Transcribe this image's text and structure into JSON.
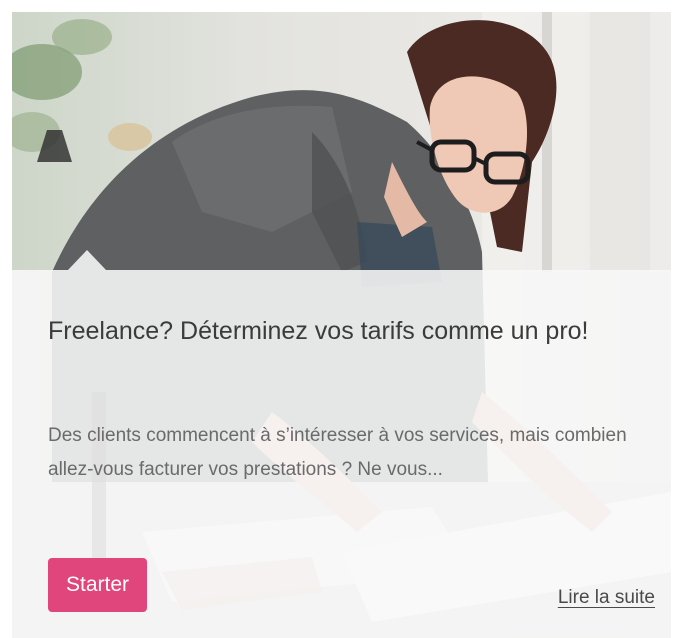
{
  "card": {
    "title": "Freelance? Déterminez vos tarifs comme un pro!",
    "excerpt": "Des clients commencent à s’intéresser à vos services, mais combien allez-vous facturer vos prestations ? Ne vous...",
    "category_label": "Starter",
    "read_more_label": "Lire la suite",
    "image_alt": "woman-with-glasses-working-at-desk-photo"
  },
  "colors": {
    "accent": "#e0457b",
    "overlay": "#f8f8f8"
  }
}
